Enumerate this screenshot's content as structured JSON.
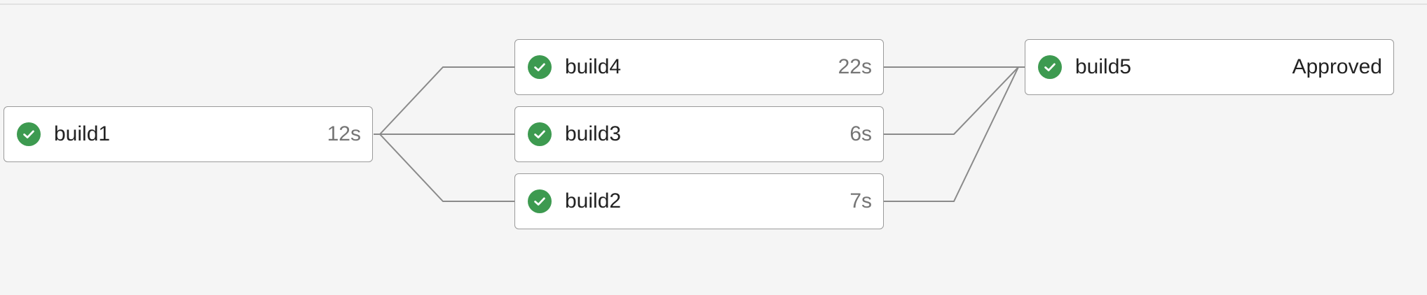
{
  "pipeline": {
    "jobs": [
      {
        "id": "build1",
        "name": "build1",
        "meta": "12s",
        "status": "success"
      },
      {
        "id": "build4",
        "name": "build4",
        "meta": "22s",
        "status": "success"
      },
      {
        "id": "build3",
        "name": "build3",
        "meta": "6s",
        "status": "success"
      },
      {
        "id": "build2",
        "name": "build2",
        "meta": "7s",
        "status": "success"
      },
      {
        "id": "build5",
        "name": "build5",
        "meta": "Approved",
        "status": "success"
      }
    ],
    "edges": [
      {
        "from": "build1",
        "to": "build4"
      },
      {
        "from": "build1",
        "to": "build3"
      },
      {
        "from": "build1",
        "to": "build2"
      },
      {
        "from": "build4",
        "to": "build5"
      },
      {
        "from": "build3",
        "to": "build5"
      },
      {
        "from": "build2",
        "to": "build5"
      }
    ],
    "colors": {
      "success": "#3d9a50",
      "edge": "#8a8a8a",
      "card_border": "#9a9a9a",
      "background": "#f5f5f5"
    },
    "icons": {
      "status": "check-circle-icon"
    }
  }
}
